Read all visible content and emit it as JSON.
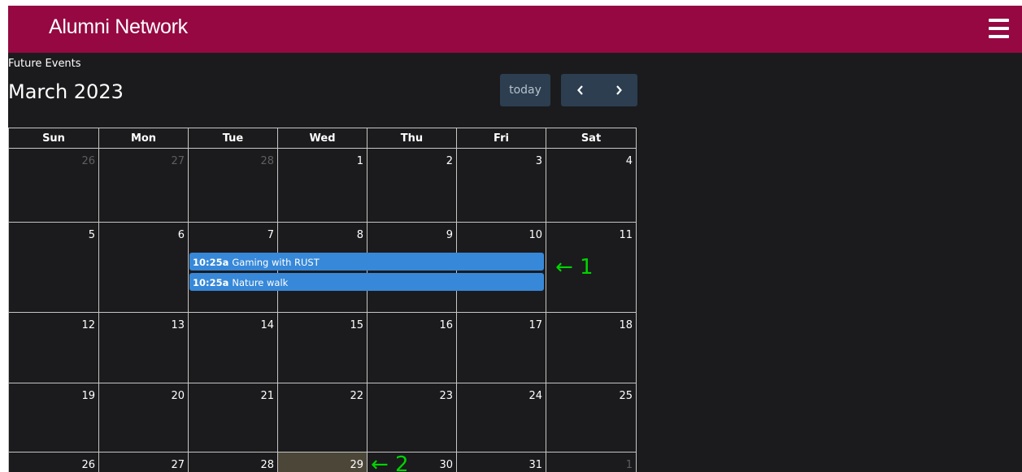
{
  "app": {
    "brand": "Alumni Network",
    "accent_color": "#960842",
    "menu_icon": "hamburger-menu-icon"
  },
  "page": {
    "subtitle": "Future Events"
  },
  "calendar": {
    "month_title": "March 2023",
    "today_label": "today",
    "prev_icon": "chevron-left-icon",
    "next_icon": "chevron-right-icon",
    "weekdays": [
      "Sun",
      "Mon",
      "Tue",
      "Wed",
      "Thu",
      "Fri",
      "Sat"
    ],
    "weeks": [
      [
        "26",
        "27",
        "28",
        "1",
        "2",
        "3",
        "4"
      ],
      [
        "5",
        "6",
        "7",
        "8",
        "9",
        "10",
        "11"
      ],
      [
        "12",
        "13",
        "14",
        "15",
        "16",
        "17",
        "18"
      ],
      [
        "19",
        "20",
        "21",
        "22",
        "23",
        "24",
        "25"
      ],
      [
        "26",
        "27",
        "28",
        "29",
        "30",
        "31",
        "1"
      ]
    ],
    "today_date": "29",
    "events": [
      {
        "time": "10:25a",
        "title": "Gaming with RUST"
      },
      {
        "time": "10:25a",
        "title": "Nature walk"
      }
    ],
    "event_color": "#3788d8"
  },
  "annotations": [
    "← 1",
    "← 2"
  ],
  "annotation_color": "#00d400"
}
